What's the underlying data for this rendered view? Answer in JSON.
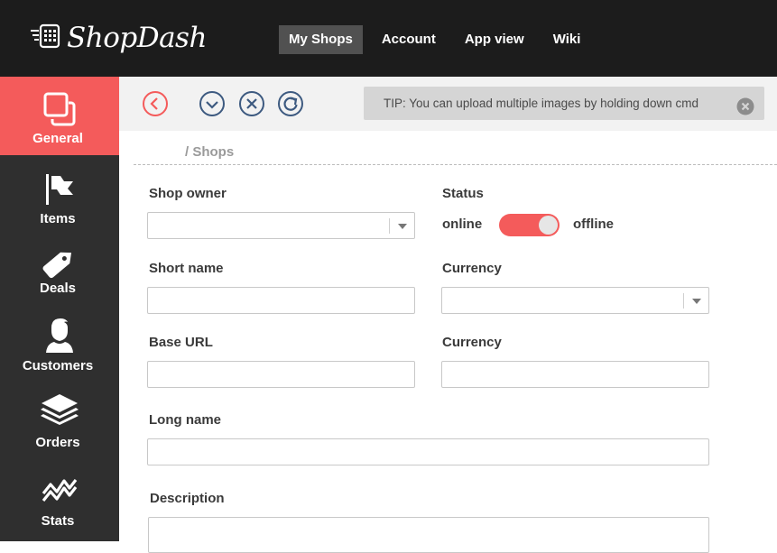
{
  "app": {
    "name": "ShopDash"
  },
  "nav": {
    "items": [
      {
        "label": "My Shops",
        "active": true
      },
      {
        "label": "Account"
      },
      {
        "label": "App view"
      },
      {
        "label": "Wiki"
      }
    ]
  },
  "sidebar": {
    "items": [
      {
        "label": "General",
        "icon": "copy-icon",
        "active": true
      },
      {
        "label": "Items",
        "icon": "flag-icon"
      },
      {
        "label": "Deals",
        "icon": "tag-icon"
      },
      {
        "label": "Customers",
        "icon": "user-icon"
      },
      {
        "label": "Orders",
        "icon": "layers-icon"
      },
      {
        "label": "Stats",
        "icon": "trend-icon"
      }
    ]
  },
  "tip": {
    "text": "TIP: You can upload multiple images by holding down cmd"
  },
  "breadcrumb": {
    "text": "/ Shops"
  },
  "form": {
    "shop_owner": {
      "label": "Shop owner",
      "value": ""
    },
    "status": {
      "label": "Status",
      "on_label": "online",
      "off_label": "offline"
    },
    "short_name": {
      "label": "Short name",
      "value": ""
    },
    "currency_select": {
      "label": "Currency",
      "value": ""
    },
    "base_url": {
      "label": "Base URL",
      "value": ""
    },
    "currency_text": {
      "label": "Currency",
      "value": ""
    },
    "long_name": {
      "label": "Long name",
      "value": ""
    },
    "description": {
      "label": "Description",
      "value": ""
    }
  },
  "colors": {
    "accent": "#f45b5b",
    "topbar": "#1c1c1c",
    "sidebar": "#2f2f2f",
    "toolbar_icon": "#3d5a80"
  }
}
